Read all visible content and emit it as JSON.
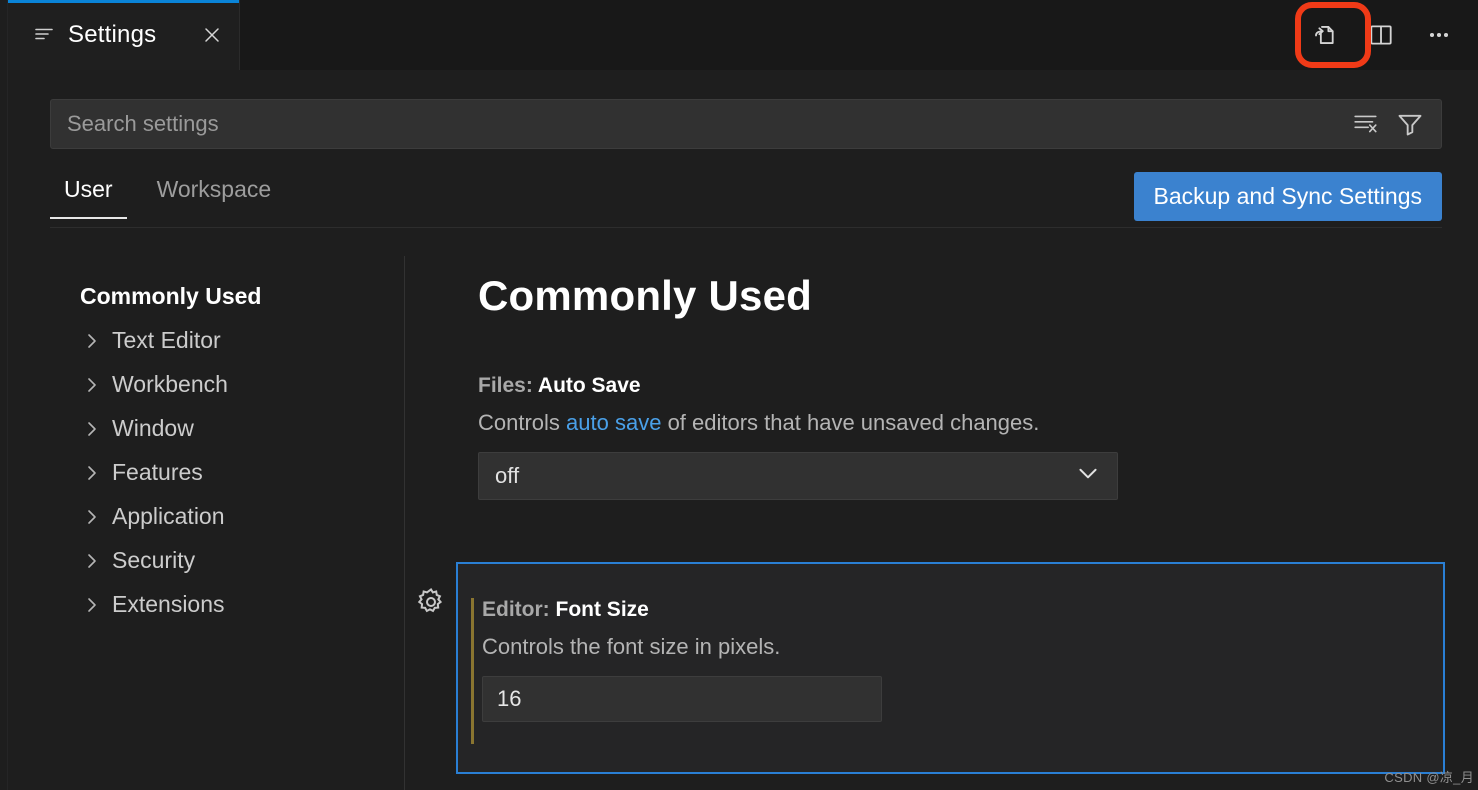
{
  "window": {
    "tab": {
      "label": "Settings",
      "icon": "settings-list-icon",
      "close_icon": "close-icon",
      "active": "true"
    },
    "editor_actions": [
      {
        "name": "open-settings-json-button",
        "icon": "open-file-json-icon",
        "tooltip": "Open Settings (JSON)",
        "highlighted": "true"
      },
      {
        "name": "split-editor-button",
        "icon": "split-editor-icon",
        "tooltip": "Split Editor"
      },
      {
        "name": "more-actions-button",
        "icon": "ellipsis-icon",
        "tooltip": "More Actions..."
      }
    ],
    "annotation_color": "#f03a17"
  },
  "search": {
    "placeholder": "Search settings",
    "value": "",
    "actions": [
      {
        "name": "clear-search-button",
        "icon": "clear-search-icon"
      },
      {
        "name": "filter-settings-button",
        "icon": "filter-funnel-icon"
      }
    ]
  },
  "scope": {
    "tabs": [
      {
        "label": "User",
        "active": true
      },
      {
        "label": "Workspace",
        "active": false
      }
    ],
    "sync_button": {
      "label": "Backup and Sync Settings",
      "color": "#3b82cf"
    }
  },
  "toc": {
    "items": [
      {
        "label": "Commonly Used",
        "selected": true,
        "expandable": false
      },
      {
        "label": "Text Editor",
        "selected": false,
        "expandable": true
      },
      {
        "label": "Workbench",
        "selected": false,
        "expandable": true
      },
      {
        "label": "Window",
        "selected": false,
        "expandable": true
      },
      {
        "label": "Features",
        "selected": false,
        "expandable": true
      },
      {
        "label": "Application",
        "selected": false,
        "expandable": true
      },
      {
        "label": "Security",
        "selected": false,
        "expandable": true
      },
      {
        "label": "Extensions",
        "selected": false,
        "expandable": true
      }
    ]
  },
  "main": {
    "heading": "Commonly Used",
    "settings": [
      {
        "category": "Files: ",
        "name": "Auto Save",
        "description_before": "Controls ",
        "description_link": "auto save",
        "description_after": " of editors that have unsaved changes.",
        "control": "dropdown",
        "value": "off",
        "chevron_icon": "chevron-down-icon"
      },
      {
        "category": "Editor: ",
        "name": "Font Size",
        "description": "Controls the font size in pixels.",
        "control": "number-input",
        "value": "16",
        "modified": true,
        "focused": true,
        "gear_icon": "gear-icon",
        "modified_color": "#8a7530",
        "focus_color": "#2a7fd4"
      }
    ]
  },
  "watermark": {
    "text": "CSDN @凉_月"
  }
}
